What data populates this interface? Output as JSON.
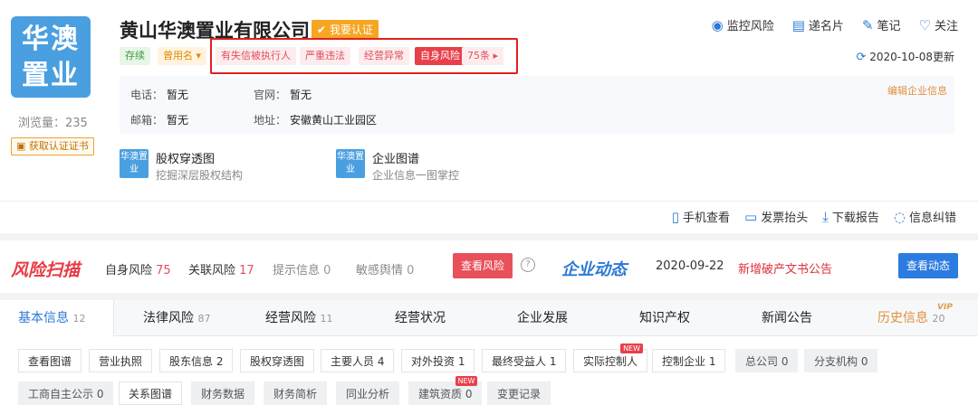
{
  "company": {
    "logo_text": "华澳置业",
    "name": "黄山华澳置业有限公司",
    "verify_label": "我要认证",
    "views_label": "浏览量：235",
    "cert_button": "获取认证证书"
  },
  "tags": {
    "status": "存续",
    "former_name": "曾用名",
    "dishonest": "有失信被执行人",
    "violation": "严重违法",
    "abnormal": "经营异常",
    "self_risk": "自身风险",
    "risk_count": "75条"
  },
  "actions": {
    "monitor": "监控风险",
    "card": "递名片",
    "note": "笔记",
    "follow": "关注",
    "updated": "2020-10-08更新"
  },
  "info": {
    "phone_label": "电话：",
    "phone_value": "暂无",
    "website_label": "官网：",
    "website_value": "暂无",
    "email_label": "邮箱：",
    "email_value": "暂无",
    "address_label": "地址：",
    "address_value": "安徽黄山工业园区",
    "edit_link": "编辑企业信息"
  },
  "tools": {
    "equity_title": "股权穿透图",
    "equity_sub": "挖掘深层股权结构",
    "graph_title": "企业图谱",
    "graph_sub": "企业信息一图掌控",
    "mini_logo": "华澳置业"
  },
  "toolbar2": {
    "mobile": "手机查看",
    "invoice": "发票抬头",
    "report": "下载报告",
    "correct": "信息纠错"
  },
  "risk": {
    "logo": "风险扫描",
    "self_label": "自身风险",
    "self_count": "75",
    "related_label": "关联风险",
    "related_count": "17",
    "hint_label": "提示信息",
    "hint_count": "0",
    "opinion_label": "敏感舆情",
    "opinion_count": "0",
    "view_button": "查看风险",
    "dyn_logo": "企业动态",
    "dyn_date": "2020-09-22",
    "dyn_text": "新增破产文书公告",
    "dyn_button": "查看动态"
  },
  "tabs": [
    {
      "label": "基本信息",
      "count": "12"
    },
    {
      "label": "法律风险",
      "count": "87"
    },
    {
      "label": "经营风险",
      "count": "11"
    },
    {
      "label": "经营状况",
      "count": ""
    },
    {
      "label": "企业发展",
      "count": ""
    },
    {
      "label": "知识产权",
      "count": ""
    },
    {
      "label": "新闻公告",
      "count": ""
    },
    {
      "label": "历史信息",
      "count": "20"
    }
  ],
  "vip_badge": "VIP",
  "chips": [
    "查看图谱",
    "营业执照",
    "股东信息 2",
    "股权穿透图",
    "主要人员 4",
    "对外投资 1",
    "最终受益人 1",
    "实际控制人",
    "控制企业 1",
    "总公司 0",
    "分支机构 0",
    "工商自主公示 0",
    "关系图谱",
    "财务数据",
    "财务简析",
    "同业分析",
    "建筑资质 0",
    "变更记录"
  ],
  "new_badge": "NEW"
}
